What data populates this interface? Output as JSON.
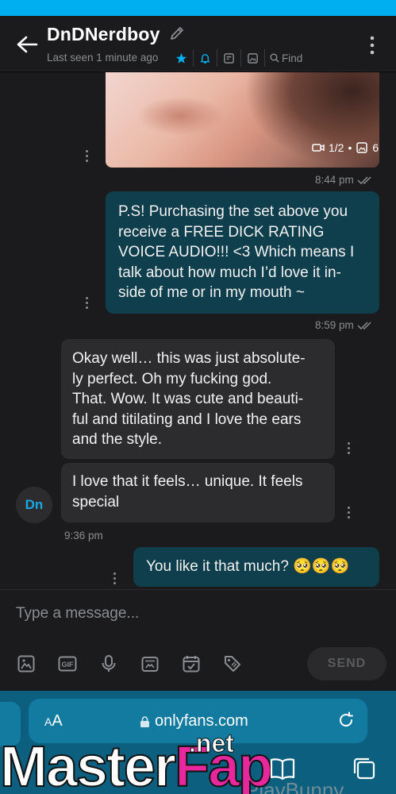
{
  "header": {
    "title": "DnDNerdboy",
    "last_seen": "Last seen 1 minute ago",
    "find_label": "Find",
    "accent": "#00aff0"
  },
  "messages": {
    "media_count_video": "1/2",
    "media_count_photo": "6",
    "time_1": "8:44 pm",
    "out_1": "P.S! Purchasing the set above you\nreceive a FREE DICK RATING\nVOICE AUDIO!!! <3 Which means I\ntalk about how much I’d love it in-\nside of me or in my mouth ~",
    "time_2": "8:59 pm",
    "in_1": "Okay well… this was just absolute-\nly perfect. Oh my fucking god.\nThat. Wow. It was cute and beauti-\nful and titilating and I love the ears\nand the style.",
    "in_2": "I love that it feels… unique. It feels\nspecial",
    "avatar_initials": "Dn",
    "time_3": "9:36 pm",
    "out_2": "You like it that much? 🥺🥺🥺"
  },
  "composer": {
    "placeholder": "Type a message...",
    "send_label": "SEND"
  },
  "browser": {
    "aa_label": "AA",
    "url": "onlyfans.com"
  },
  "watermark": {
    "part1": "Master",
    "part2": "Fap",
    "tld": ".net",
    "ghost": "PlayBunny"
  }
}
